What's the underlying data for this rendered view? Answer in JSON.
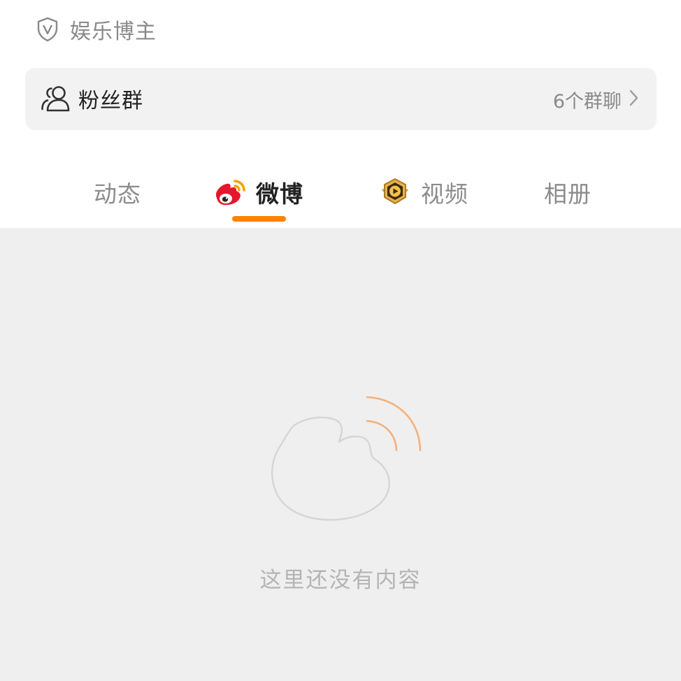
{
  "profile": {
    "verified_label": "娱乐博主",
    "verified_icon": "shield-v-icon"
  },
  "fans_group": {
    "label": "粉丝群",
    "count_text": "6个群聊",
    "icon": "users-icon",
    "chevron": "chevron-right-icon"
  },
  "tabs": [
    {
      "label": "动态",
      "active": false,
      "icon": null
    },
    {
      "label": "微博",
      "active": true,
      "icon": "weibo-logo-icon"
    },
    {
      "label": "视频",
      "active": false,
      "icon": "video-badge-icon"
    },
    {
      "label": "相册",
      "active": false,
      "icon": null
    }
  ],
  "empty_state": {
    "message": "这里还没有内容",
    "icon": "weibo-empty-illustration"
  },
  "colors": {
    "accent": "#ff8200",
    "card_bg": "#f2f2f2",
    "content_bg": "#efefef",
    "muted_text": "#8a8a8a",
    "empty_text": "#b4b4b4"
  }
}
